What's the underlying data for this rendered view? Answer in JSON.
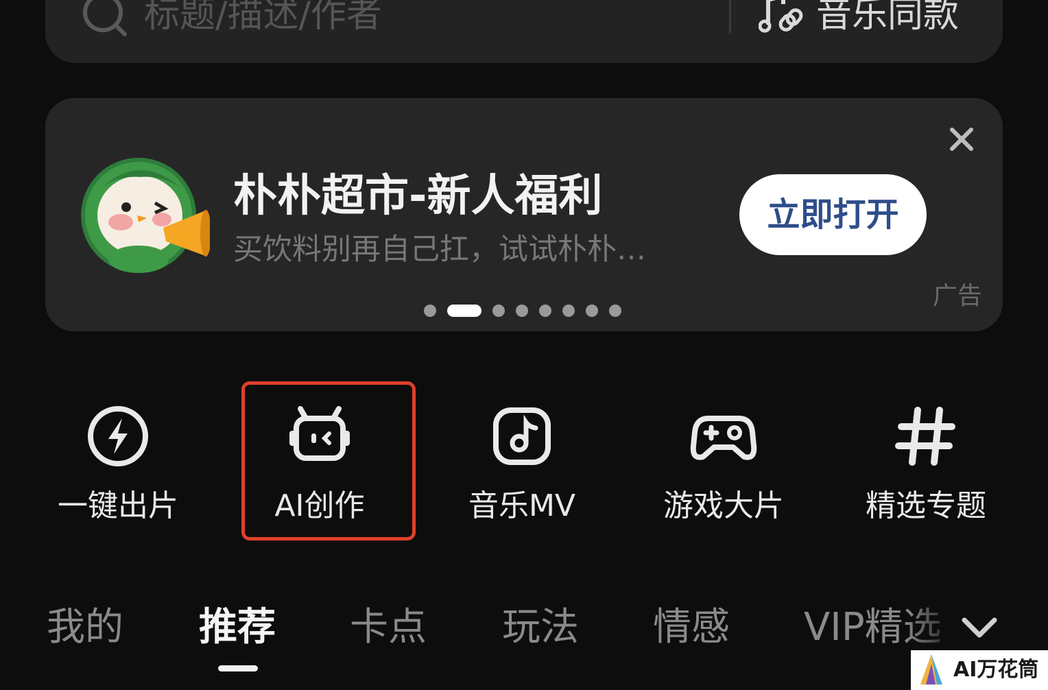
{
  "search": {
    "placeholder": "标题/描述/作者",
    "music_same_label": "音乐同款"
  },
  "ad": {
    "title": "朴朴超市-新人福利",
    "subtitle": "买饮料别再自己扛，试试朴朴…",
    "button_label": "立即打开",
    "tag": "广告",
    "carousel_total": 8,
    "carousel_active_index": 1
  },
  "quick_actions": [
    {
      "label": "一键出片",
      "icon": "lightning-icon"
    },
    {
      "label": "AI创作",
      "icon": "robot-icon",
      "highlighted": true
    },
    {
      "label": "音乐MV",
      "icon": "music-note-icon"
    },
    {
      "label": "游戏大片",
      "icon": "gamepad-icon"
    },
    {
      "label": "精选专题",
      "icon": "hashtag-icon"
    }
  ],
  "tabs": [
    {
      "label": "我的",
      "active": false
    },
    {
      "label": "推荐",
      "active": true
    },
    {
      "label": "卡点",
      "active": false
    },
    {
      "label": "玩法",
      "active": false
    },
    {
      "label": "情感",
      "active": false
    },
    {
      "label": "VIP精选",
      "active": false
    }
  ],
  "watermark": {
    "text": "AI万花筒"
  },
  "colors": {
    "background": "#0d0d0d",
    "card": "#262626",
    "highlight_border": "#e0402a",
    "button_text": "#2e4d8a"
  }
}
